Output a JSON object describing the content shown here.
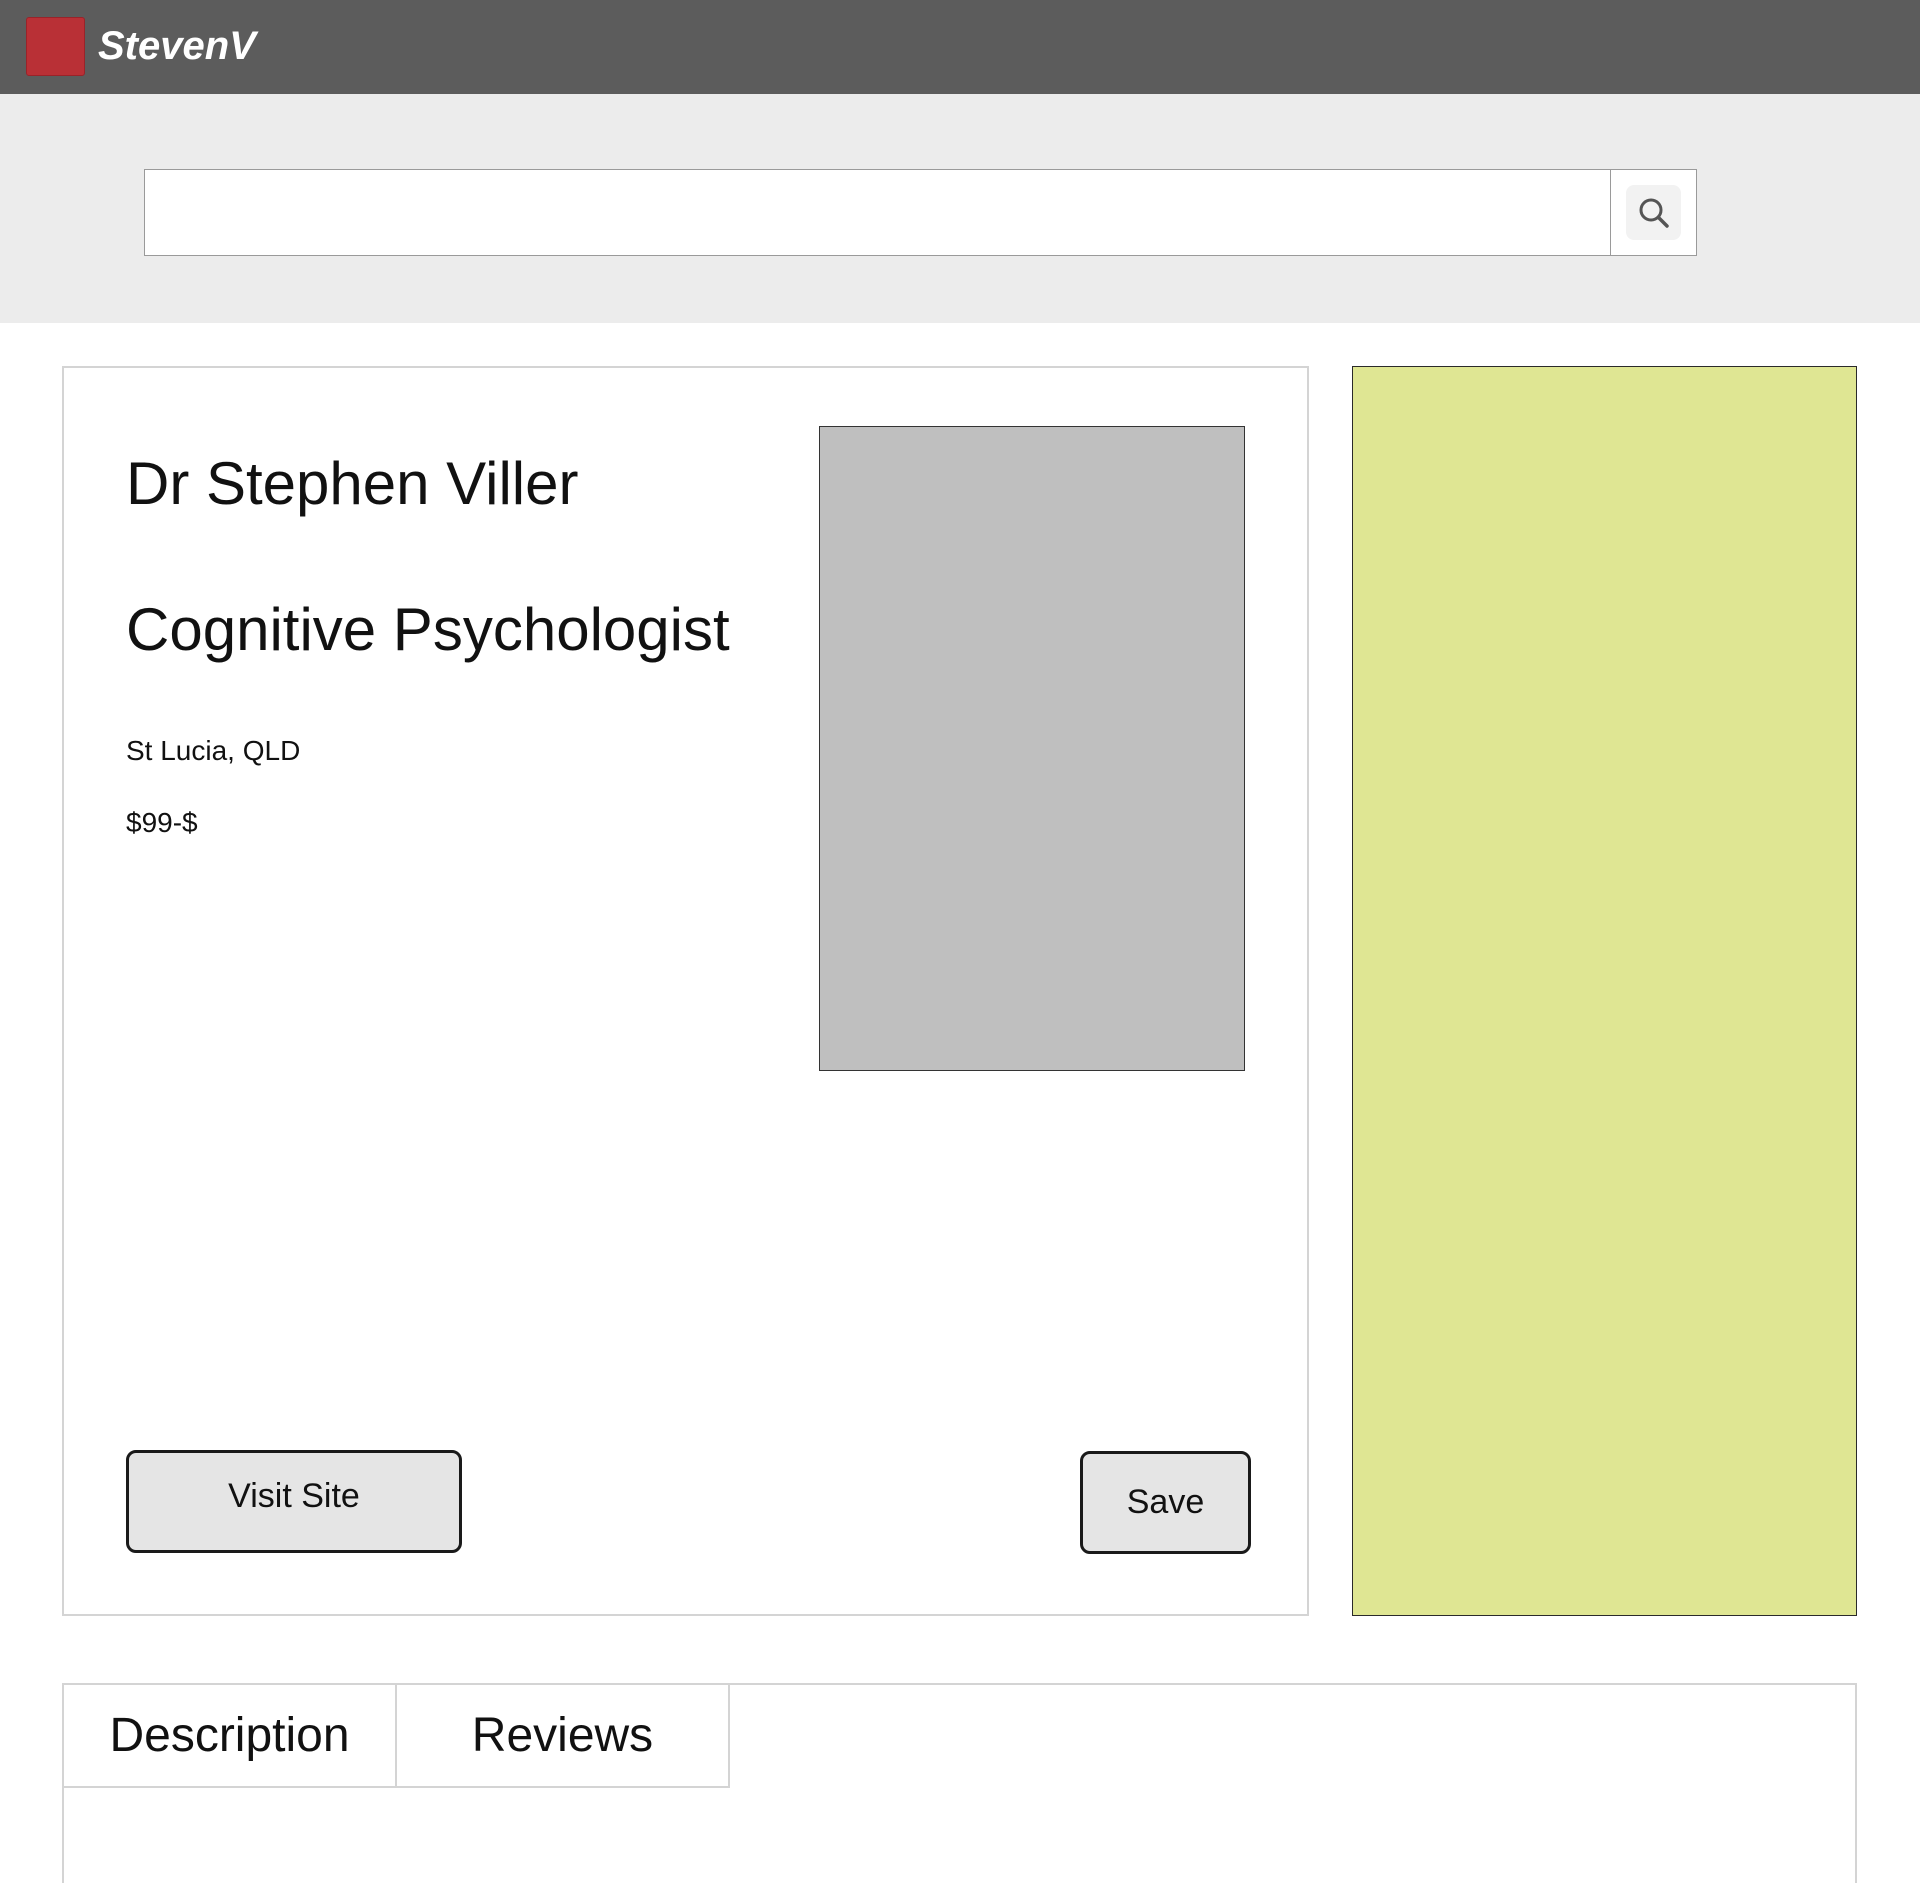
{
  "header": {
    "brand": "StevenV",
    "logo_color": "#b93036",
    "bar_color": "#5c5c5c"
  },
  "search": {
    "value": "",
    "placeholder": "",
    "icon": "search-icon"
  },
  "profile": {
    "name": "Dr Stephen Viller",
    "title": "Cognitive Psychologist",
    "location": "St Lucia, QLD",
    "price": "$99-$",
    "visit_label": "Visit Site",
    "save_label": "Save",
    "photo_color": "#bfbfbf"
  },
  "side_panel": {
    "color": "#dfe693"
  },
  "tabs": [
    {
      "label": "Description"
    },
    {
      "label": "Reviews"
    }
  ]
}
